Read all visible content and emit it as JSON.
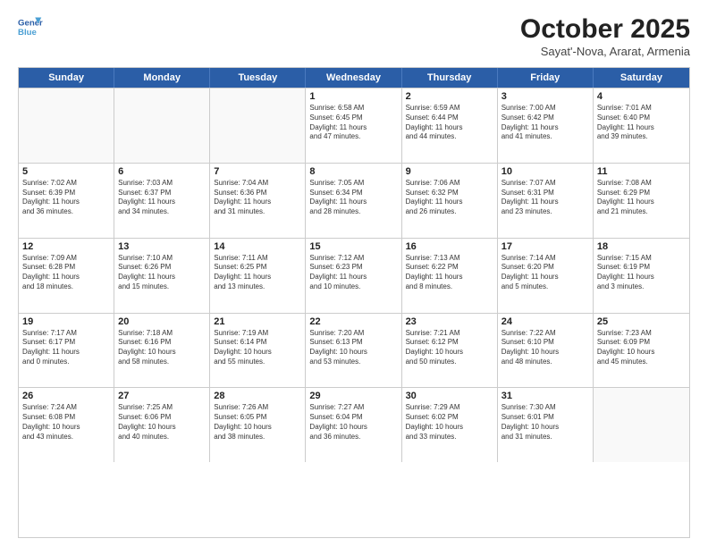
{
  "header": {
    "logo_line1": "General",
    "logo_line2": "Blue",
    "month": "October 2025",
    "location": "Sayat'-Nova, Ararat, Armenia"
  },
  "weekdays": [
    "Sunday",
    "Monday",
    "Tuesday",
    "Wednesday",
    "Thursday",
    "Friday",
    "Saturday"
  ],
  "weeks": [
    [
      {
        "day": "",
        "text": ""
      },
      {
        "day": "",
        "text": ""
      },
      {
        "day": "",
        "text": ""
      },
      {
        "day": "1",
        "text": "Sunrise: 6:58 AM\nSunset: 6:45 PM\nDaylight: 11 hours\nand 47 minutes."
      },
      {
        "day": "2",
        "text": "Sunrise: 6:59 AM\nSunset: 6:44 PM\nDaylight: 11 hours\nand 44 minutes."
      },
      {
        "day": "3",
        "text": "Sunrise: 7:00 AM\nSunset: 6:42 PM\nDaylight: 11 hours\nand 41 minutes."
      },
      {
        "day": "4",
        "text": "Sunrise: 7:01 AM\nSunset: 6:40 PM\nDaylight: 11 hours\nand 39 minutes."
      }
    ],
    [
      {
        "day": "5",
        "text": "Sunrise: 7:02 AM\nSunset: 6:39 PM\nDaylight: 11 hours\nand 36 minutes."
      },
      {
        "day": "6",
        "text": "Sunrise: 7:03 AM\nSunset: 6:37 PM\nDaylight: 11 hours\nand 34 minutes."
      },
      {
        "day": "7",
        "text": "Sunrise: 7:04 AM\nSunset: 6:36 PM\nDaylight: 11 hours\nand 31 minutes."
      },
      {
        "day": "8",
        "text": "Sunrise: 7:05 AM\nSunset: 6:34 PM\nDaylight: 11 hours\nand 28 minutes."
      },
      {
        "day": "9",
        "text": "Sunrise: 7:06 AM\nSunset: 6:32 PM\nDaylight: 11 hours\nand 26 minutes."
      },
      {
        "day": "10",
        "text": "Sunrise: 7:07 AM\nSunset: 6:31 PM\nDaylight: 11 hours\nand 23 minutes."
      },
      {
        "day": "11",
        "text": "Sunrise: 7:08 AM\nSunset: 6:29 PM\nDaylight: 11 hours\nand 21 minutes."
      }
    ],
    [
      {
        "day": "12",
        "text": "Sunrise: 7:09 AM\nSunset: 6:28 PM\nDaylight: 11 hours\nand 18 minutes."
      },
      {
        "day": "13",
        "text": "Sunrise: 7:10 AM\nSunset: 6:26 PM\nDaylight: 11 hours\nand 15 minutes."
      },
      {
        "day": "14",
        "text": "Sunrise: 7:11 AM\nSunset: 6:25 PM\nDaylight: 11 hours\nand 13 minutes."
      },
      {
        "day": "15",
        "text": "Sunrise: 7:12 AM\nSunset: 6:23 PM\nDaylight: 11 hours\nand 10 minutes."
      },
      {
        "day": "16",
        "text": "Sunrise: 7:13 AM\nSunset: 6:22 PM\nDaylight: 11 hours\nand 8 minutes."
      },
      {
        "day": "17",
        "text": "Sunrise: 7:14 AM\nSunset: 6:20 PM\nDaylight: 11 hours\nand 5 minutes."
      },
      {
        "day": "18",
        "text": "Sunrise: 7:15 AM\nSunset: 6:19 PM\nDaylight: 11 hours\nand 3 minutes."
      }
    ],
    [
      {
        "day": "19",
        "text": "Sunrise: 7:17 AM\nSunset: 6:17 PM\nDaylight: 11 hours\nand 0 minutes."
      },
      {
        "day": "20",
        "text": "Sunrise: 7:18 AM\nSunset: 6:16 PM\nDaylight: 10 hours\nand 58 minutes."
      },
      {
        "day": "21",
        "text": "Sunrise: 7:19 AM\nSunset: 6:14 PM\nDaylight: 10 hours\nand 55 minutes."
      },
      {
        "day": "22",
        "text": "Sunrise: 7:20 AM\nSunset: 6:13 PM\nDaylight: 10 hours\nand 53 minutes."
      },
      {
        "day": "23",
        "text": "Sunrise: 7:21 AM\nSunset: 6:12 PM\nDaylight: 10 hours\nand 50 minutes."
      },
      {
        "day": "24",
        "text": "Sunrise: 7:22 AM\nSunset: 6:10 PM\nDaylight: 10 hours\nand 48 minutes."
      },
      {
        "day": "25",
        "text": "Sunrise: 7:23 AM\nSunset: 6:09 PM\nDaylight: 10 hours\nand 45 minutes."
      }
    ],
    [
      {
        "day": "26",
        "text": "Sunrise: 7:24 AM\nSunset: 6:08 PM\nDaylight: 10 hours\nand 43 minutes."
      },
      {
        "day": "27",
        "text": "Sunrise: 7:25 AM\nSunset: 6:06 PM\nDaylight: 10 hours\nand 40 minutes."
      },
      {
        "day": "28",
        "text": "Sunrise: 7:26 AM\nSunset: 6:05 PM\nDaylight: 10 hours\nand 38 minutes."
      },
      {
        "day": "29",
        "text": "Sunrise: 7:27 AM\nSunset: 6:04 PM\nDaylight: 10 hours\nand 36 minutes."
      },
      {
        "day": "30",
        "text": "Sunrise: 7:29 AM\nSunset: 6:02 PM\nDaylight: 10 hours\nand 33 minutes."
      },
      {
        "day": "31",
        "text": "Sunrise: 7:30 AM\nSunset: 6:01 PM\nDaylight: 10 hours\nand 31 minutes."
      },
      {
        "day": "",
        "text": ""
      }
    ]
  ]
}
